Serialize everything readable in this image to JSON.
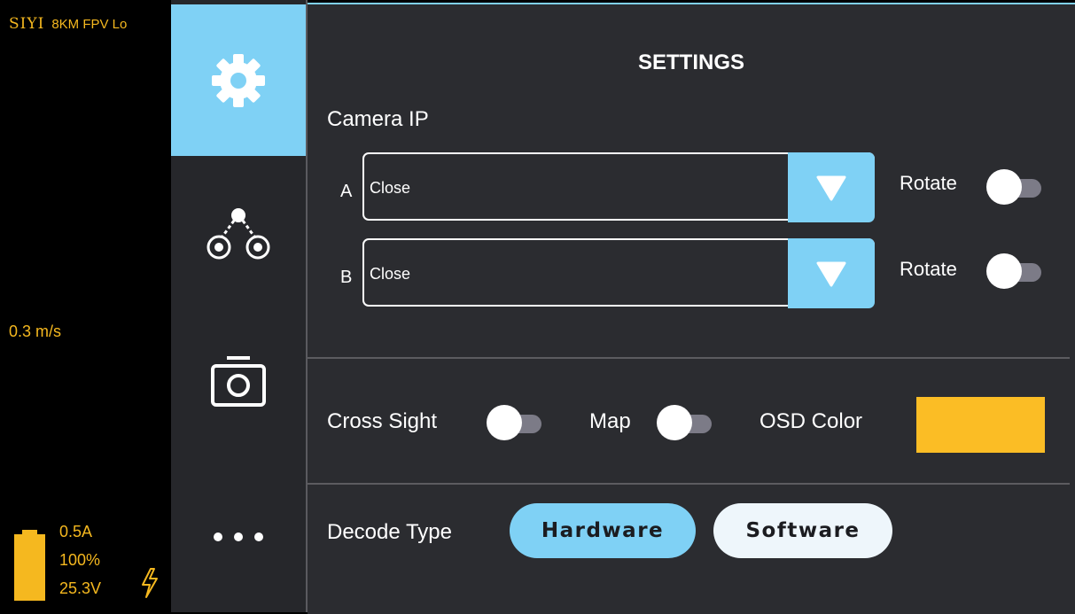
{
  "osd": {
    "brand_logo": "SIYI",
    "brand_text": "8KM FPV Lo",
    "speed": "0.3 m/s",
    "current": "0.5A",
    "battery_percent": "100%",
    "battery_level": 1.0,
    "voltage": "25.3V",
    "accent_color": "#f5b81f"
  },
  "nav": {
    "items": [
      {
        "icon": "gear-icon",
        "active": true
      },
      {
        "icon": "gimbal-icon",
        "active": false
      },
      {
        "icon": "camera-icon",
        "active": false
      },
      {
        "icon": "more-icon",
        "active": false
      }
    ],
    "active_color": "#7fd1f5"
  },
  "settings": {
    "title": "SETTINGS",
    "camera_ip_label": "Camera IP",
    "camera_a": {
      "letter": "A",
      "value": "Close",
      "rotate_label": "Rotate",
      "rotate_on": false
    },
    "camera_b": {
      "letter": "B",
      "value": "Close",
      "rotate_label": "Rotate",
      "rotate_on": false
    },
    "cross_sight_label": "Cross Sight",
    "cross_sight_on": false,
    "map_label": "Map",
    "map_on": false,
    "osd_color_label": "OSD Color",
    "osd_color": "#fbbd25",
    "decode_type_label": "Decode Type",
    "decode_options": [
      "Hardware",
      "Software"
    ],
    "decode_selected": "Hardware"
  }
}
